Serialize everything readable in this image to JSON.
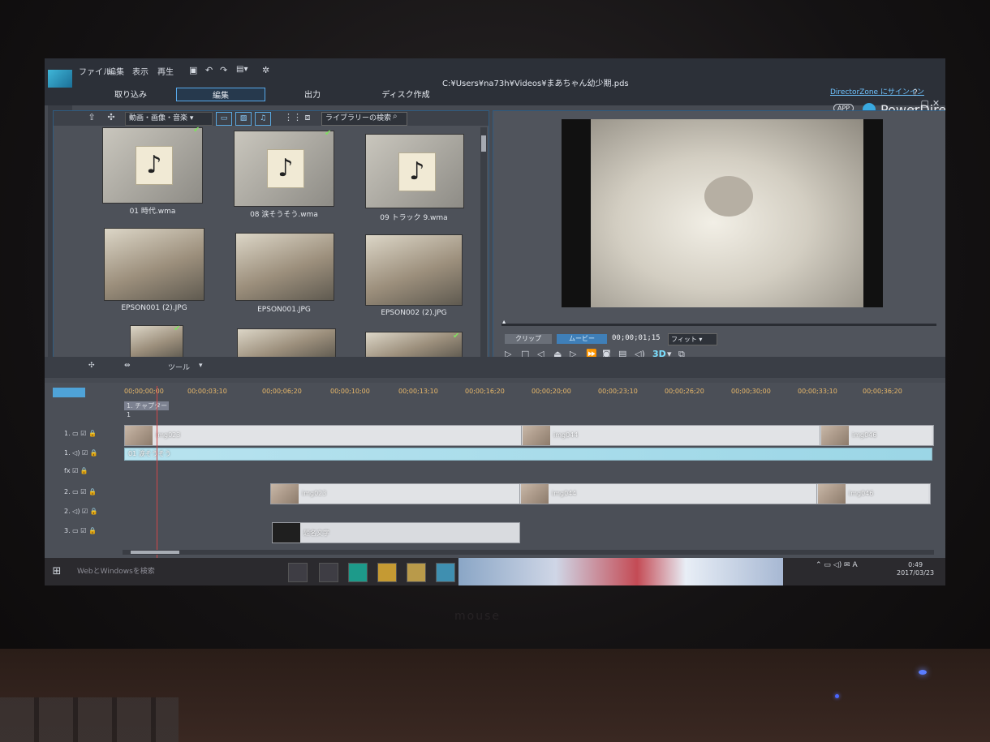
{
  "menu": [
    "ファイル",
    "編集",
    "表示",
    "再生"
  ],
  "file_path": "C:¥Users¥na73h¥Videos¥まあちゃん幼少期.pds",
  "main_tabs": [
    {
      "label": "取り込み",
      "active": false
    },
    {
      "label": "編集",
      "active": true
    },
    {
      "label": "出力",
      "active": false
    },
    {
      "label": "ディスク作成",
      "active": false
    }
  ],
  "director_zone": "DirectorZone にサインイン",
  "app_badge": "APP",
  "brand": "PowerDirector",
  "library": {
    "filter": "動画・画像・音楽",
    "search_placeholder": "ライブラリーの検索",
    "items": [
      {
        "name": "01 時代.wma",
        "kind": "music",
        "checked": true
      },
      {
        "name": "08 涙そうそう.wma",
        "kind": "music",
        "checked": true
      },
      {
        "name": "09 トラック 9.wma",
        "kind": "music",
        "checked": false
      },
      {
        "name": "EPSON001 (2).JPG",
        "kind": "photo",
        "checked": false
      },
      {
        "name": "EPSON001.JPG",
        "kind": "photo",
        "checked": false
      },
      {
        "name": "EPSON002 (2).JPG",
        "kind": "photo",
        "checked": false
      }
    ]
  },
  "preview": {
    "clip_label": "クリップ",
    "movie_label": "ムービー",
    "timecode": "00;00;01;15",
    "fit_label": "フィット",
    "mode_3d": "3D"
  },
  "toolbar": {
    "tools_label": "ツール"
  },
  "timeline": {
    "ruler": [
      "00;00;00;00",
      "00;00;03;10",
      "00;00;06;20",
      "00;00;10;00",
      "00;00;13;10",
      "00;00;16;20",
      "00;00;20;00",
      "00;00;23;10",
      "00;00;26;20",
      "00;00;30;00",
      "00;00;33;10",
      "00;00;36;20"
    ],
    "chapter": "1. チャプター 1",
    "track_labels": [
      "1.",
      "1.",
      "fx",
      "2.",
      "2.",
      "3."
    ],
    "video1": [
      "img023",
      "img044",
      "img046"
    ],
    "audio1": "01 涙そうそう",
    "video2": [
      "img023",
      "img044",
      "img046"
    ],
    "title3": "題名文字"
  },
  "taskbar": {
    "search_text": "WebとWindowsを検索",
    "time": "0:49",
    "date": "2017/03/23"
  }
}
